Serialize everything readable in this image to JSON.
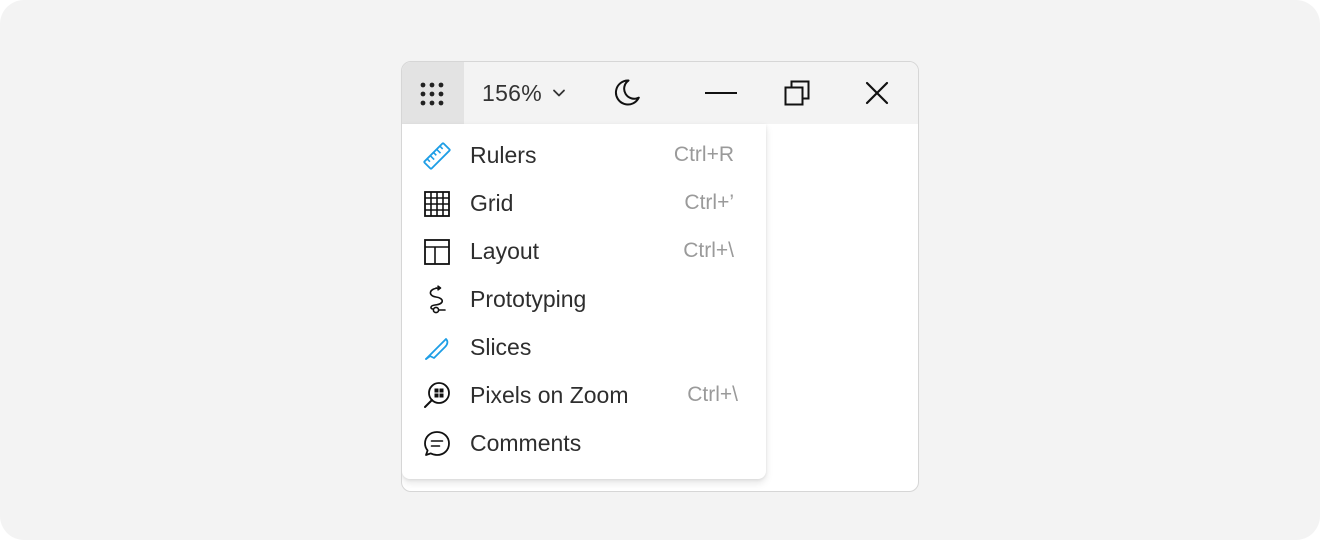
{
  "toolbar": {
    "menu_icon": "apps-grid-icon",
    "zoom_value": "156%",
    "zoom_chevron_icon": "chevron-down-icon",
    "theme_icon": "moon-icon",
    "minimize_icon": "minimize-icon",
    "maximize_icon": "restore-window-icon",
    "close_icon": "close-icon"
  },
  "menu": {
    "items": [
      {
        "label": "Rulers",
        "shortcut": "Ctrl+R",
        "icon": "ruler-icon",
        "icon_color": "#1e9ee6"
      },
      {
        "label": "Grid",
        "shortcut": "Ctrl+’",
        "icon": "grid-icon",
        "icon_color": "#111111"
      },
      {
        "label": "Layout",
        "shortcut": "Ctrl+\\",
        "icon": "layout-icon",
        "icon_color": "#111111"
      },
      {
        "label": "Prototyping",
        "shortcut": "",
        "icon": "prototype-path-icon",
        "icon_color": "#111111"
      },
      {
        "label": "Slices",
        "shortcut": "",
        "icon": "knife-icon",
        "icon_color": "#1e9ee6"
      },
      {
        "label": "Pixels on Zoom",
        "shortcut": "Ctrl+\\",
        "icon": "pixel-magnifier-icon",
        "icon_color": "#111111"
      },
      {
        "label": "Comments",
        "shortcut": "",
        "icon": "comment-icon",
        "icon_color": "#111111"
      }
    ]
  },
  "colors": {
    "background": "#f3f3f3",
    "accent": "#1e9ee6",
    "text": "#2e2e2e",
    "shortcut_text": "#9a9a9a"
  }
}
